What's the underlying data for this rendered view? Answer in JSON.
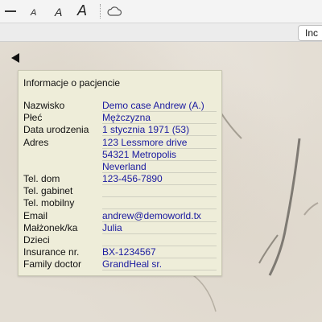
{
  "toolbar": {
    "font_small": "A",
    "font_medium": "A",
    "font_large": "A"
  },
  "subbar": {
    "tab_label": "Inc"
  },
  "card": {
    "title": "Informacje o pacjencie",
    "fields": [
      {
        "label": "Nazwisko",
        "value": "Demo case Andrew (A.)"
      },
      {
        "label": "Płeć",
        "value": "Mężczyzna"
      },
      {
        "label": "Data urodzenia",
        "value": "1 stycznia 1971 (53)"
      },
      {
        "label": "Adres",
        "value": "123 Lessmore drive"
      },
      {
        "label": "",
        "value": "54321  Metropolis"
      },
      {
        "label": "",
        "value": "Neverland"
      },
      {
        "label": "Tel. dom",
        "value": "123-456-7890"
      },
      {
        "label": "Tel. gabinet",
        "value": ""
      },
      {
        "label": "Tel. mobilny",
        "value": ""
      },
      {
        "label": "Email",
        "value": "andrew@demoworld.tx"
      },
      {
        "label": "Małżonek/ka",
        "value": "Julia"
      },
      {
        "label": "Dzieci",
        "value": ""
      },
      {
        "label": "Insurance nr.",
        "value": "BX-1234567"
      },
      {
        "label": "Family doctor",
        "value": "GrandHeal sr."
      }
    ]
  },
  "colors": {
    "value_text": "#1a1aa0",
    "card_bg": "#eeedd9"
  }
}
